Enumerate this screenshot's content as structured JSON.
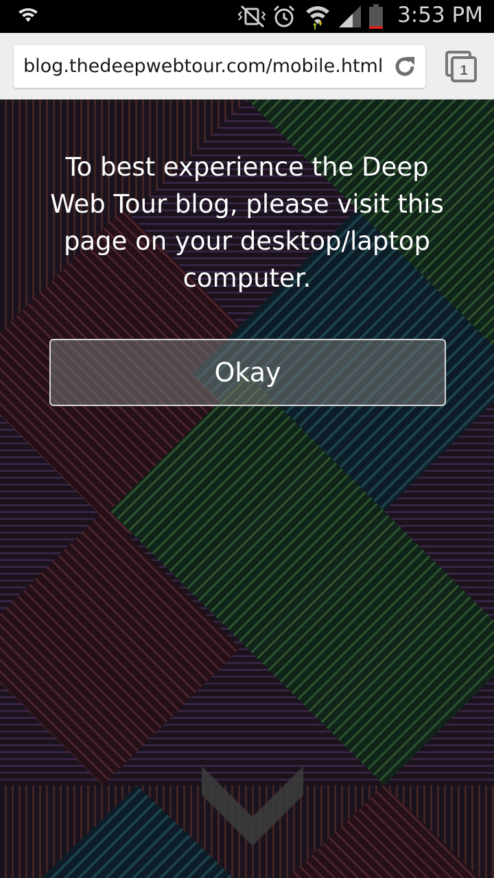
{
  "status_bar": {
    "time": "3:53 PM",
    "icons": [
      "shield-icon",
      "vibrate-off-icon",
      "alarm-icon",
      "wifi-icon",
      "signal-icon",
      "battery-icon"
    ]
  },
  "browser": {
    "url": "blog.thedeepwebtour.com/mobile.html",
    "tab_count": "1",
    "icons": [
      "reload-icon",
      "tabs-icon"
    ]
  },
  "page": {
    "message": "To best experience the Deep Web Tour blog, please visit this page on your desktop/laptop computer.",
    "button_label": "Okay",
    "icons": [
      "chevron-down-icon"
    ]
  }
}
